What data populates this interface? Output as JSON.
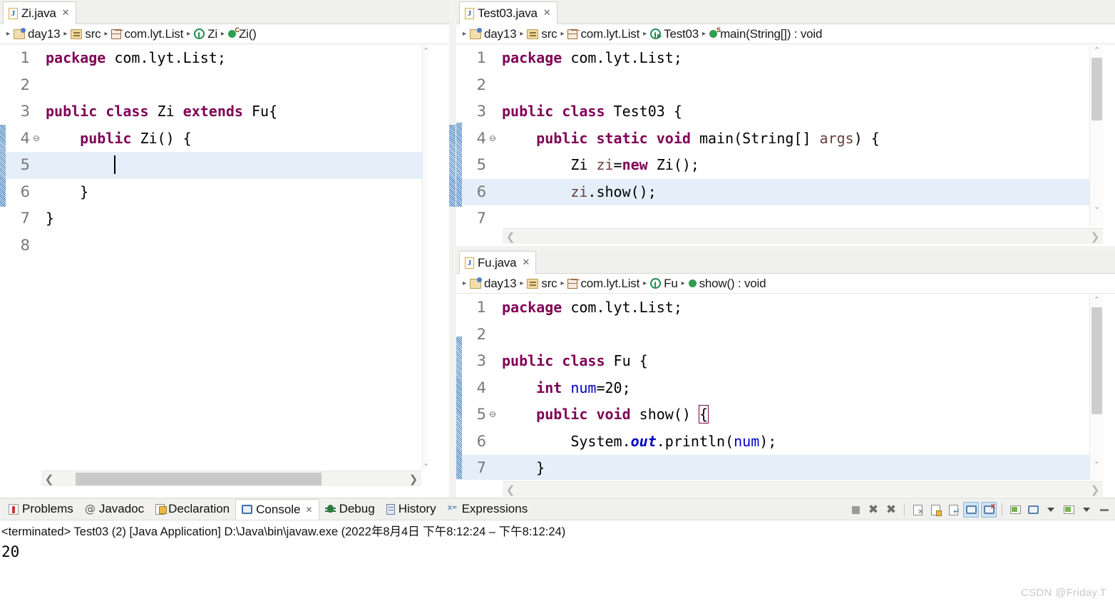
{
  "editors": {
    "left": {
      "tab": {
        "label": "Zi.java",
        "close": "✕",
        "icon": "java-file-icon"
      },
      "breadcrumb": [
        {
          "label": "day13",
          "icon": "project-icon"
        },
        {
          "label": "src",
          "icon": "source-folder-icon"
        },
        {
          "label": "com.lyt.List",
          "icon": "package-icon"
        },
        {
          "label": "Zi",
          "icon": "class-icon"
        },
        {
          "label": "Zi()",
          "icon": "constructor-icon"
        }
      ],
      "lines": [
        {
          "n": "1",
          "fold": "",
          "hl": false,
          "tokens": [
            {
              "t": "package",
              "c": "kw"
            },
            {
              "t": " com.lyt.List;",
              "c": "id"
            }
          ]
        },
        {
          "n": "2",
          "fold": "",
          "hl": false,
          "tokens": []
        },
        {
          "n": "3",
          "fold": "",
          "hl": false,
          "tokens": [
            {
              "t": "public class ",
              "c": "kw"
            },
            {
              "t": "Zi ",
              "c": "id"
            },
            {
              "t": "extends ",
              "c": "kw"
            },
            {
              "t": "Fu{",
              "c": "id"
            }
          ]
        },
        {
          "n": "4",
          "fold": "⊖",
          "hl": false,
          "tokens": [
            {
              "t": "    ",
              "c": "id"
            },
            {
              "t": "public ",
              "c": "kw"
            },
            {
              "t": "Zi() {",
              "c": "id"
            }
          ]
        },
        {
          "n": "5",
          "fold": "",
          "hl": true,
          "caret": true,
          "tokens": [
            {
              "t": "        ",
              "c": "id"
            }
          ]
        },
        {
          "n": "6",
          "fold": "",
          "hl": false,
          "tokens": [
            {
              "t": "    }",
              "c": "id"
            }
          ]
        },
        {
          "n": "7",
          "fold": "",
          "hl": false,
          "tokens": [
            {
              "t": "}",
              "c": "id"
            }
          ]
        },
        {
          "n": "8",
          "fold": "",
          "hl": false,
          "tokens": []
        }
      ]
    },
    "topright": {
      "tab": {
        "label": "Test03.java",
        "close": "✕",
        "icon": "java-file-icon"
      },
      "breadcrumb": [
        {
          "label": "day13",
          "icon": "project-icon"
        },
        {
          "label": "src",
          "icon": "source-folder-icon"
        },
        {
          "label": "com.lyt.List",
          "icon": "package-icon"
        },
        {
          "label": "Test03",
          "icon": "runnable-class-icon"
        },
        {
          "label": "main(String[]) : void",
          "icon": "static-method-icon"
        }
      ],
      "lines": [
        {
          "n": "1",
          "fold": "",
          "hl": false,
          "tokens": [
            {
              "t": "package",
              "c": "kw"
            },
            {
              "t": " com.lyt.List;",
              "c": "id"
            }
          ]
        },
        {
          "n": "2",
          "fold": "",
          "hl": false,
          "tokens": []
        },
        {
          "n": "3",
          "fold": "",
          "hl": false,
          "tokens": [
            {
              "t": "public class ",
              "c": "kw"
            },
            {
              "t": "Test03 {",
              "c": "id"
            }
          ]
        },
        {
          "n": "4",
          "fold": "⊖",
          "hl": false,
          "tokens": [
            {
              "t": "    ",
              "c": "id"
            },
            {
              "t": "public static void ",
              "c": "kw"
            },
            {
              "t": "main(String[] ",
              "c": "id"
            },
            {
              "t": "args",
              "c": "loc"
            },
            {
              "t": ") {",
              "c": "id"
            }
          ]
        },
        {
          "n": "5",
          "fold": "",
          "hl": false,
          "tokens": [
            {
              "t": "        Zi ",
              "c": "id"
            },
            {
              "t": "zi",
              "c": "loc"
            },
            {
              "t": "=",
              "c": "id"
            },
            {
              "t": "new ",
              "c": "kw"
            },
            {
              "t": "Zi();",
              "c": "id"
            }
          ]
        },
        {
          "n": "6",
          "fold": "",
          "hl": true,
          "tokens": [
            {
              "t": "        ",
              "c": "id"
            },
            {
              "t": "zi",
              "c": "loc"
            },
            {
              "t": ".show();",
              "c": "id"
            }
          ]
        },
        {
          "n": "7",
          "fold": "",
          "hl": false,
          "tokens": []
        }
      ]
    },
    "bottomright": {
      "tab": {
        "label": "Fu.java",
        "close": "✕",
        "icon": "java-file-icon"
      },
      "breadcrumb": [
        {
          "label": "day13",
          "icon": "project-icon"
        },
        {
          "label": "src",
          "icon": "source-folder-icon"
        },
        {
          "label": "com.lyt.List",
          "icon": "package-icon"
        },
        {
          "label": "Fu",
          "icon": "class-icon"
        },
        {
          "label": "show() : void",
          "icon": "method-icon"
        }
      ],
      "lines": [
        {
          "n": "1",
          "fold": "",
          "hl": false,
          "tokens": [
            {
              "t": "package",
              "c": "kw"
            },
            {
              "t": " com.lyt.List;",
              "c": "id"
            }
          ]
        },
        {
          "n": "2",
          "fold": "",
          "hl": false,
          "tokens": []
        },
        {
          "n": "3",
          "fold": "",
          "hl": false,
          "tokens": [
            {
              "t": "public class ",
              "c": "kw"
            },
            {
              "t": "Fu {",
              "c": "id"
            }
          ]
        },
        {
          "n": "4",
          "fold": "",
          "hl": false,
          "tokens": [
            {
              "t": "    ",
              "c": "id"
            },
            {
              "t": "int ",
              "c": "kw"
            },
            {
              "t": "num",
              "c": "fld"
            },
            {
              "t": "=20;",
              "c": "id"
            }
          ]
        },
        {
          "n": "5",
          "fold": "⊖",
          "hl": false,
          "tokens": [
            {
              "t": "    ",
              "c": "id"
            },
            {
              "t": "public void ",
              "c": "kw"
            },
            {
              "t": "show() ",
              "c": "id"
            },
            {
              "t": "{",
              "c": "brk"
            }
          ]
        },
        {
          "n": "6",
          "fold": "",
          "hl": false,
          "tokens": [
            {
              "t": "        System.",
              "c": "id"
            },
            {
              "t": "out",
              "c": "stat"
            },
            {
              "t": ".println(",
              "c": "id"
            },
            {
              "t": "num",
              "c": "fld"
            },
            {
              "t": ");",
              "c": "id"
            }
          ]
        },
        {
          "n": "7",
          "fold": "",
          "hl": true,
          "tokens": [
            {
              "t": "    }",
              "c": "id"
            }
          ]
        }
      ]
    }
  },
  "bottom_view": {
    "tabs": [
      {
        "label": "Problems",
        "icon": "problems-icon",
        "active": false,
        "close": false
      },
      {
        "label": "Javadoc",
        "icon": "javadoc-at-icon",
        "active": false,
        "close": false
      },
      {
        "label": "Declaration",
        "icon": "declaration-icon",
        "active": false,
        "close": false
      },
      {
        "label": "Console",
        "icon": "console-icon",
        "active": true,
        "close": true
      },
      {
        "label": "Debug",
        "icon": "debug-bug-icon",
        "active": false,
        "close": false
      },
      {
        "label": "History",
        "icon": "history-icon",
        "active": false,
        "close": false
      },
      {
        "label": "Expressions",
        "icon": "expressions-icon",
        "active": false,
        "close": false
      }
    ],
    "tab_close_glyph": "✕",
    "status_line": "<terminated> Test03 (2) [Java Application] D:\\Java\\bin\\javaw.exe  (2022年8月4日 下午8:12:24 – 下午8:12:24)",
    "output": "20",
    "toolbar": [
      {
        "name": "terminate-button",
        "glyph": "stop"
      },
      {
        "name": "remove-launch-button",
        "glyph": "x"
      },
      {
        "name": "remove-all-terminated-button",
        "glyph": "xx"
      },
      {
        "name": "clear-console-button",
        "glyph": "clear"
      },
      {
        "name": "scroll-lock-button",
        "glyph": "lock"
      },
      {
        "name": "word-wrap-button",
        "glyph": "wrap"
      },
      {
        "name": "show-console-on-output-button",
        "glyph": "stdout",
        "selected": true
      },
      {
        "name": "show-console-on-error-button",
        "glyph": "stderr",
        "selected": true
      },
      {
        "name": "pin-console-button",
        "glyph": "pin"
      },
      {
        "name": "display-selected-console-button",
        "glyph": "monitor"
      },
      {
        "name": "display-selected-console-menu",
        "glyph": "caret"
      },
      {
        "name": "open-console-button",
        "glyph": "newconsole"
      },
      {
        "name": "open-console-menu",
        "glyph": "caret"
      },
      {
        "name": "minimize-button",
        "glyph": "minimize"
      }
    ]
  },
  "watermark": "CSDN @Friday.T"
}
